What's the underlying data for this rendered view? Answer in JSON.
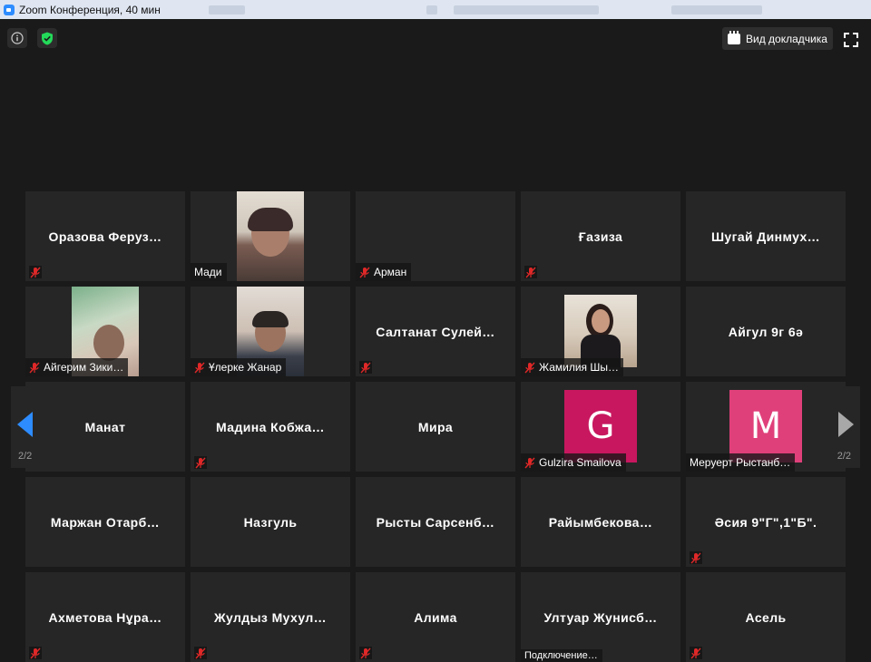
{
  "window": {
    "title": "Zoom Конференция, 40 мин"
  },
  "toolbar": {
    "speaker_view_label": "Вид докладчика"
  },
  "icons": {
    "info": "info-icon",
    "security": "shield-check-icon",
    "speaker_view": "speaker-view-icon",
    "fullscreen": "fullscreen-icon",
    "muted": "muted-mic-icon"
  },
  "colors": {
    "background": "#1a1a1a",
    "tile": "#262626",
    "muted_red": "#e02828",
    "security_green": "#23d959",
    "nav_arrow": "#2d8cff"
  },
  "pagination": {
    "current": "2/2"
  },
  "participants": [
    {
      "name": "Оразова  Феруз…",
      "muted": true,
      "show_label": false
    },
    {
      "name": "Мади",
      "muted": false,
      "show_label": true,
      "video": true
    },
    {
      "name": "Арман",
      "muted": true,
      "show_label": true,
      "video": false
    },
    {
      "name": "Ғазиза",
      "muted": true,
      "show_label": false
    },
    {
      "name": "Шугай  Динмух…",
      "muted": false,
      "show_label": false
    },
    {
      "name": "Айгерим Зики…",
      "muted": true,
      "show_label": true,
      "video": true
    },
    {
      "name": "Ұлерке Жанар",
      "muted": true,
      "show_label": true,
      "video": true
    },
    {
      "name": "Салтанат  Сулей…",
      "muted": true,
      "show_label": false
    },
    {
      "name": "Жамилия Шы…",
      "muted": true,
      "show_label": true,
      "video": true
    },
    {
      "name": "Айгул 9г 6ә",
      "muted": false,
      "show_label": false
    },
    {
      "name": "Манат",
      "muted": false,
      "show_label": false
    },
    {
      "name": "Мадина  Кобжа…",
      "muted": true,
      "show_label": false
    },
    {
      "name": "Мира",
      "muted": false,
      "show_label": false
    },
    {
      "name": "Gulzira Smailova",
      "muted": true,
      "show_label": true,
      "avatar": "G",
      "avatar_color": "#c8175f"
    },
    {
      "name": "Меруерт Рыстанб…",
      "muted": false,
      "show_label": true,
      "avatar": "M",
      "avatar_color": "#e0407a"
    },
    {
      "name": "Маржан  Отарб…",
      "muted": false,
      "show_label": false
    },
    {
      "name": "Назгуль",
      "muted": false,
      "show_label": false
    },
    {
      "name": "Рысты  Сарсенб…",
      "muted": false,
      "show_label": false
    },
    {
      "name": "Райымбекова…",
      "muted": false,
      "show_label": false
    },
    {
      "name": "Әсия 9\"Г\",1\"Б\".",
      "muted": true,
      "show_label": false
    },
    {
      "name": "Ахметова  Нұра…",
      "muted": true,
      "show_label": false
    },
    {
      "name": "Жулдыз  Мухул…",
      "muted": true,
      "show_label": false
    },
    {
      "name": "Алима",
      "muted": true,
      "show_label": false
    },
    {
      "name": "Ултуар  Жунисб…",
      "muted": false,
      "show_label": false,
      "status": "Подключение…"
    },
    {
      "name": "Асель",
      "muted": true,
      "show_label": false
    }
  ]
}
